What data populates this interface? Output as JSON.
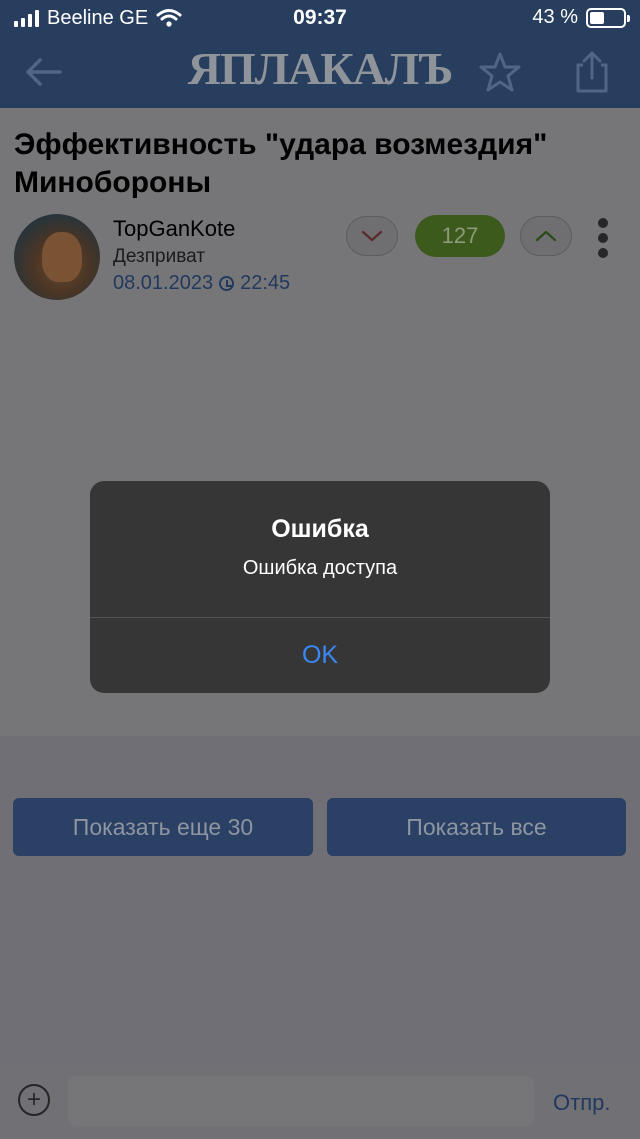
{
  "status": {
    "carrier": "Beeline GE",
    "time": "09:37",
    "battery": "43 %",
    "battery_level": 0.43
  },
  "nav": {
    "logo": "ЯПЛАКАЛЪ",
    "back_icon": "arrow-left-icon",
    "favorite_icon": "star-icon",
    "share_icon": "share-icon"
  },
  "post": {
    "title": "Эффективность \"удара возмездия\" Минобороны",
    "author": "TopGanKote",
    "role": "Дезприват",
    "date": "08.01.2023",
    "time": "22:45",
    "rating": "127"
  },
  "buttons": {
    "show_more": "Показать еще 30",
    "show_all": "Показать все"
  },
  "composer": {
    "placeholder": "",
    "send": "Отпр."
  },
  "dialog": {
    "title": "Ошибка",
    "message": "Ошибка доступа",
    "ok": "OK"
  },
  "colors": {
    "header": "#283e5f",
    "accent_link": "#3a87f5",
    "rating_bg": "#3b5a1c"
  }
}
